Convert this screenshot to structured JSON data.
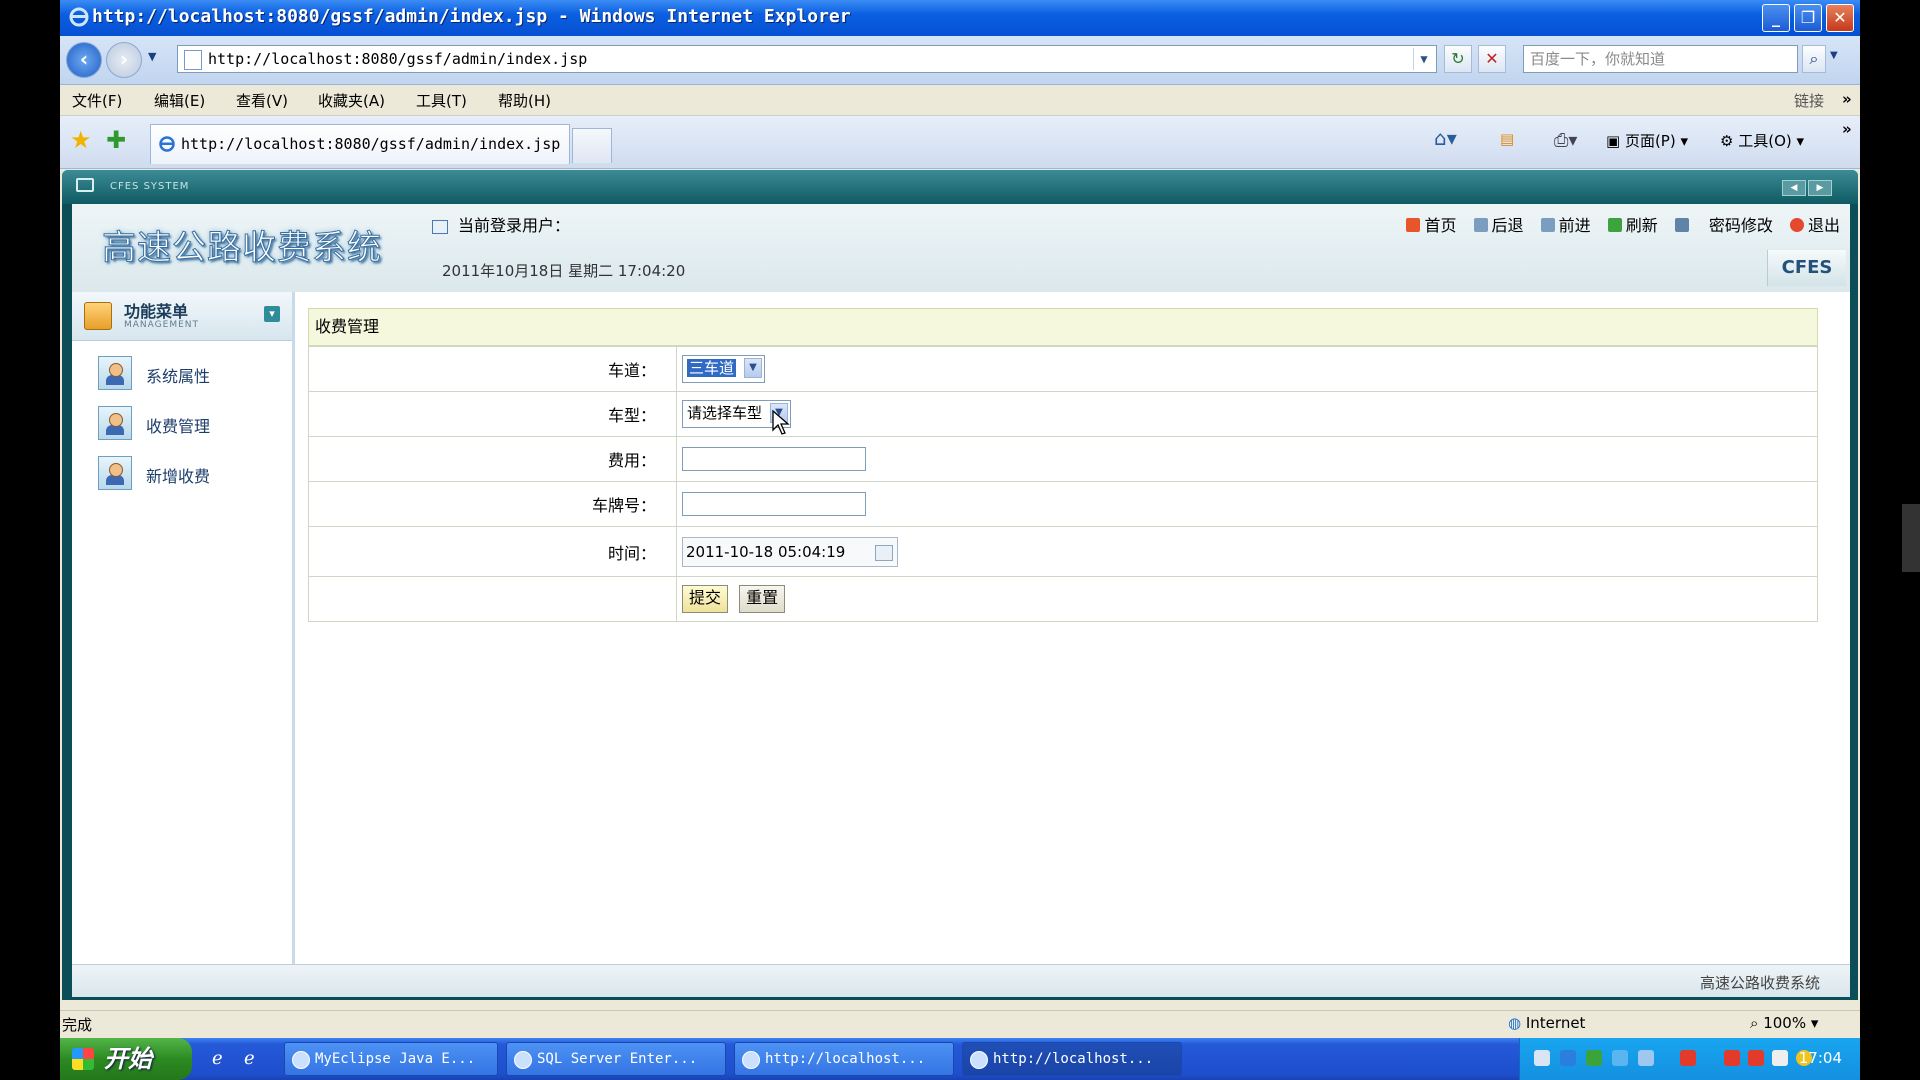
{
  "window": {
    "title": "http://localhost:8080/gssf/admin/index.jsp - Windows Internet Explorer"
  },
  "addressbar": {
    "url": "http://localhost:8080/gssf/admin/index.jsp",
    "search_placeholder": "百度一下，你就知道"
  },
  "menubar": {
    "items": [
      "文件(F)",
      "编辑(E)",
      "查看(V)",
      "收藏夹(A)",
      "工具(T)",
      "帮助(H)"
    ],
    "links_label": "链接"
  },
  "tabs": {
    "active_tab_label": "http://localhost:8080/gssf/admin/index.jsp",
    "page_menu": "页面(P)",
    "tools_menu": "工具(O)"
  },
  "app": {
    "system_label": "CFES SYSTEM",
    "logo_text": "高速公路收费系统",
    "current_user_label": "当前登录用户：",
    "datetime": "2011年10月18日 星期二 17:04:20",
    "brand": "CFES",
    "top_links": {
      "home": "首页",
      "back": "后退",
      "forward": "前进",
      "refresh": "刷新",
      "change_password": "密码修改",
      "logout": "退出"
    },
    "sidebar": {
      "title": "功能菜单",
      "subtitle": "MANAGEMENT",
      "items": [
        {
          "label": "系统属性"
        },
        {
          "label": "收费管理"
        },
        {
          "label": "新增收费"
        }
      ]
    },
    "form": {
      "title": "收费管理",
      "lane_label": "车道：",
      "lane_value": "三车道",
      "vehicle_type_label": "车型：",
      "vehicle_type_value": "请选择车型",
      "fee_label": "费用：",
      "fee_value": "",
      "plate_label": "车牌号：",
      "plate_value": "",
      "time_label": "时间：",
      "time_value": "2011-10-18 05:04:19",
      "submit_label": "提交",
      "reset_label": "重置"
    },
    "footer_text": "高速公路收费系统"
  },
  "statusbar": {
    "status": "完成",
    "zone": "Internet",
    "zoom": "100%"
  },
  "taskbar": {
    "start_label": "开始",
    "tasks": [
      {
        "label": "MyEclipse Java E..."
      },
      {
        "label": "SQL Server Enter..."
      },
      {
        "label": "http://localhost..."
      },
      {
        "label": "http://localhost..."
      }
    ],
    "clock": "17:04"
  }
}
